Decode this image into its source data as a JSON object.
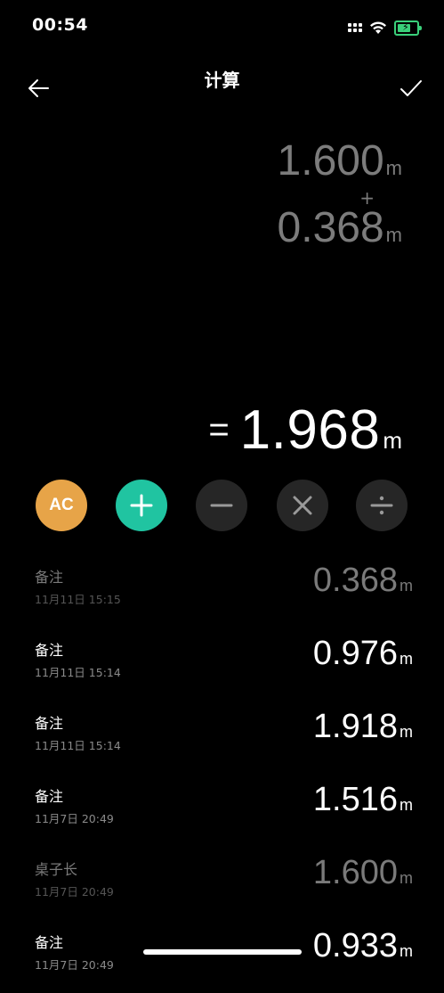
{
  "status": {
    "time": "00:54",
    "icons": [
      "signal-icon",
      "wifi-icon",
      "battery-charging-icon"
    ],
    "battery_color": "#3ad07a"
  },
  "header": {
    "title": "计算",
    "back_icon": "arrow-left-icon",
    "confirm_icon": "check-icon"
  },
  "calculation": {
    "operand_1": {
      "value": "1.600",
      "unit": "m"
    },
    "operator": "+",
    "operand_2": {
      "value": "0.368",
      "unit": "m"
    },
    "result": {
      "equals": "=",
      "value": "1.968",
      "unit": "m"
    }
  },
  "operators": {
    "clear_label": "AC",
    "clear_color": "#e7a448",
    "add_color": "#20c4a1",
    "buttons": [
      "plus-icon",
      "minus-icon",
      "times-icon",
      "divide-icon"
    ]
  },
  "history": [
    {
      "note": "备注",
      "time": "11月11日 15:15",
      "value": "0.368",
      "unit": "m",
      "dimmed": true
    },
    {
      "note": "备注",
      "time": "11月11日 15:14",
      "value": "0.976",
      "unit": "m",
      "dimmed": false
    },
    {
      "note": "备注",
      "time": "11月11日 15:14",
      "value": "1.918",
      "unit": "m",
      "dimmed": false
    },
    {
      "note": "备注",
      "time": "11月7日 20:49",
      "value": "1.516",
      "unit": "m",
      "dimmed": false
    },
    {
      "note": "桌子长",
      "time": "11月7日 20:49",
      "value": "1.600",
      "unit": "m",
      "dimmed": true
    },
    {
      "note": "备注",
      "time": "11月7日 20:49",
      "value": "0.933",
      "unit": "m",
      "dimmed": false
    }
  ]
}
